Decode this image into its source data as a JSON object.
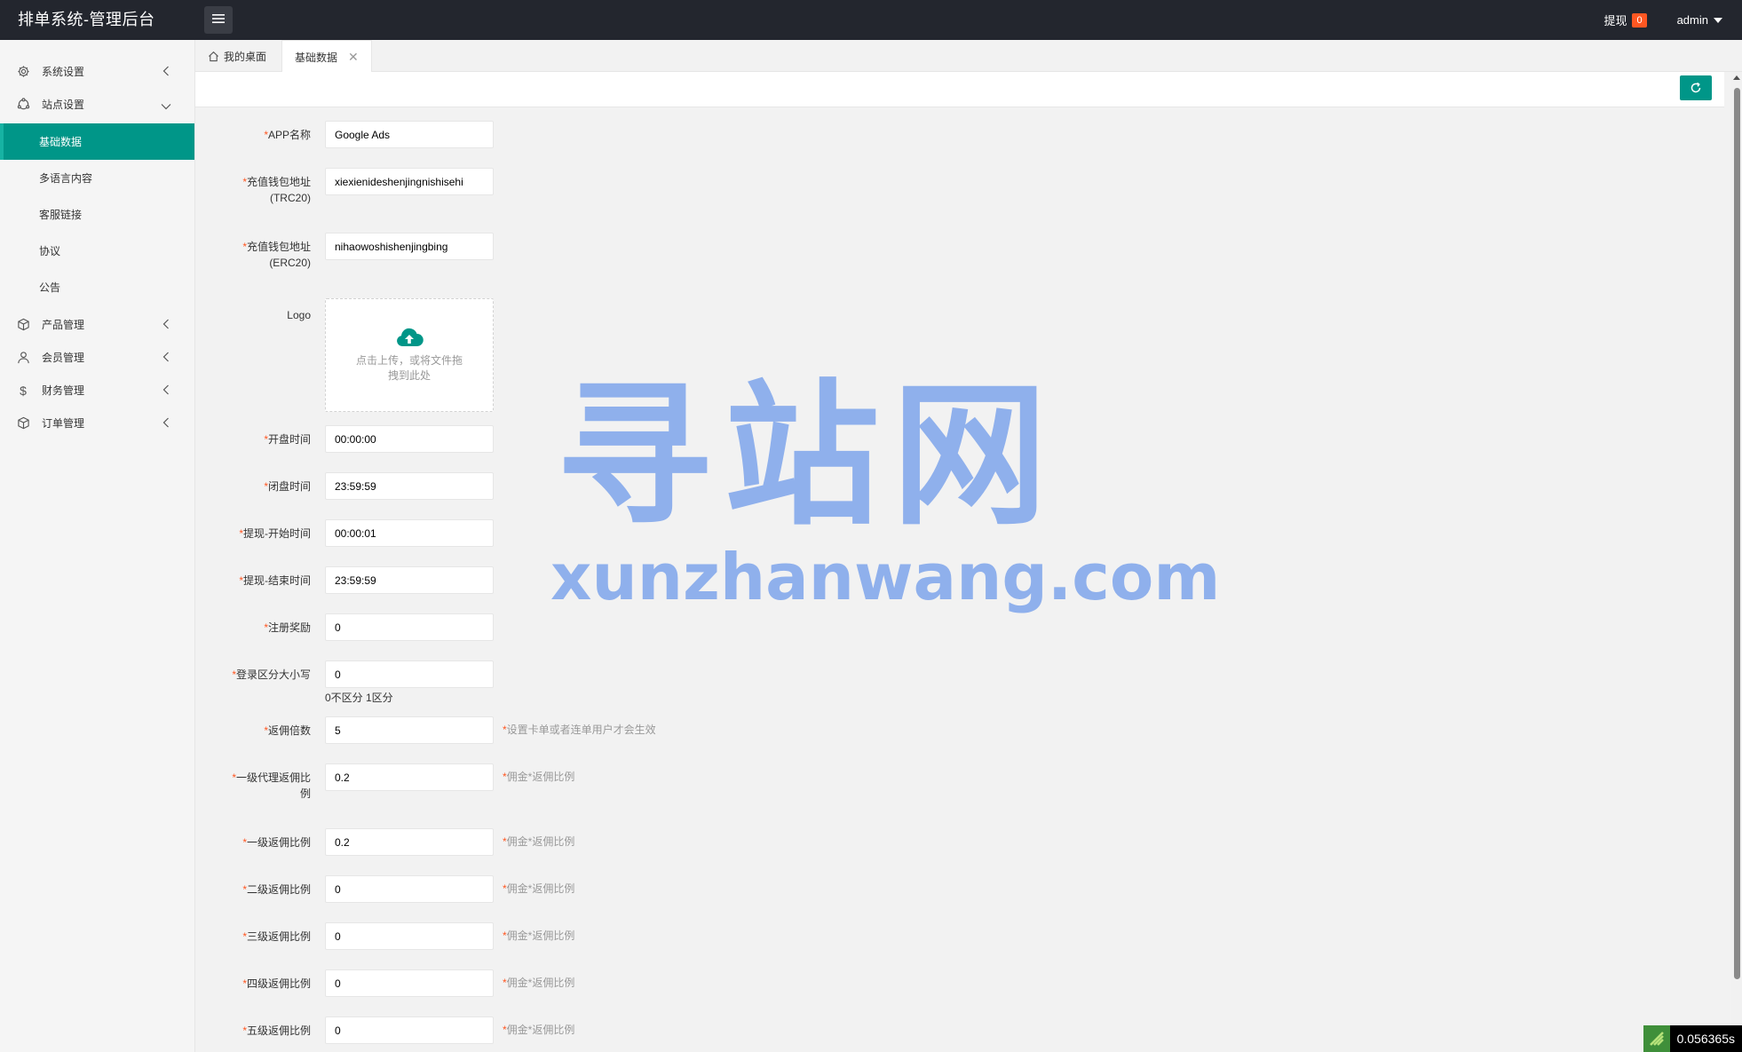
{
  "header": {
    "title": "排单系统-管理后台",
    "withdraw_label": "提现",
    "withdraw_count": "0",
    "user": "admin"
  },
  "sidebar": {
    "items": [
      {
        "label": "系统设置",
        "icon": "gear-icon"
      },
      {
        "label": "站点设置",
        "icon": "site-icon",
        "expanded": true
      },
      {
        "label": "产品管理",
        "icon": "product-icon"
      },
      {
        "label": "会员管理",
        "icon": "user-icon"
      },
      {
        "label": "财务管理",
        "icon": "dollar-icon"
      },
      {
        "label": "订单管理",
        "icon": "order-icon"
      }
    ],
    "sub_items": [
      "基础数据",
      "多语言内容",
      "客服链接",
      "协议",
      "公告"
    ],
    "active_sub": "基础数据"
  },
  "tabs": {
    "home": "我的桌面",
    "current": "基础数据"
  },
  "form": {
    "app_name": {
      "label": "APP名称",
      "value": "Google Ads"
    },
    "trc20": {
      "label_line1": "充值钱包地址",
      "label_line2": "(TRC20)",
      "value": "xiexienideshenjingnishisehi"
    },
    "erc20": {
      "label_line1": "充值钱包地址",
      "label_line2": "(ERC20)",
      "value": "nihaowoshishenjingbing"
    },
    "logo": {
      "label": "Logo",
      "upload_line1": "点击上传，或将文件拖",
      "upload_line2": "拽到此处"
    },
    "open_time": {
      "label": "开盘时间",
      "value": "00:00:00"
    },
    "close_time": {
      "label": "闭盘时间",
      "value": "23:59:59"
    },
    "withdraw_start": {
      "label": "提现-开始时间",
      "value": "00:00:01"
    },
    "withdraw_end": {
      "label": "提现-结束时间",
      "value": "23:59:59"
    },
    "register_reward": {
      "label": "注册奖励",
      "value": "0"
    },
    "login_case": {
      "label": "登录区分大小写",
      "value": "0",
      "hint": "0不区分 1区分"
    },
    "rebate_multiple": {
      "label": "返佣倍数",
      "value": "5",
      "hint": "设置卡单或者连单用户才会生效"
    },
    "agent_rate_1": {
      "label_line1": "一级代理返佣比",
      "label_line2": "例",
      "value": "0.2",
      "hint": "佣金*返佣比例"
    },
    "rate_1": {
      "label": "一级返佣比例",
      "value": "0.2",
      "hint": "佣金*返佣比例"
    },
    "rate_2": {
      "label": "二级返佣比例",
      "value": "0",
      "hint": "佣金*返佣比例"
    },
    "rate_3": {
      "label": "三级返佣比例",
      "value": "0",
      "hint": "佣金*返佣比例"
    },
    "rate_4": {
      "label": "四级返佣比例",
      "value": "0",
      "hint": "佣金*返佣比例"
    },
    "rate_5": {
      "label": "五级返佣比例",
      "value": "0",
      "hint": "佣金*返佣比例"
    }
  },
  "watermark": {
    "cn": "寻站网",
    "en": "xunzhanwang.com"
  },
  "timer": "0.056365s",
  "colors": {
    "accent": "#009688",
    "topbar": "#23262e",
    "badge": "#ff5722",
    "watermark": "#6f9bea"
  }
}
